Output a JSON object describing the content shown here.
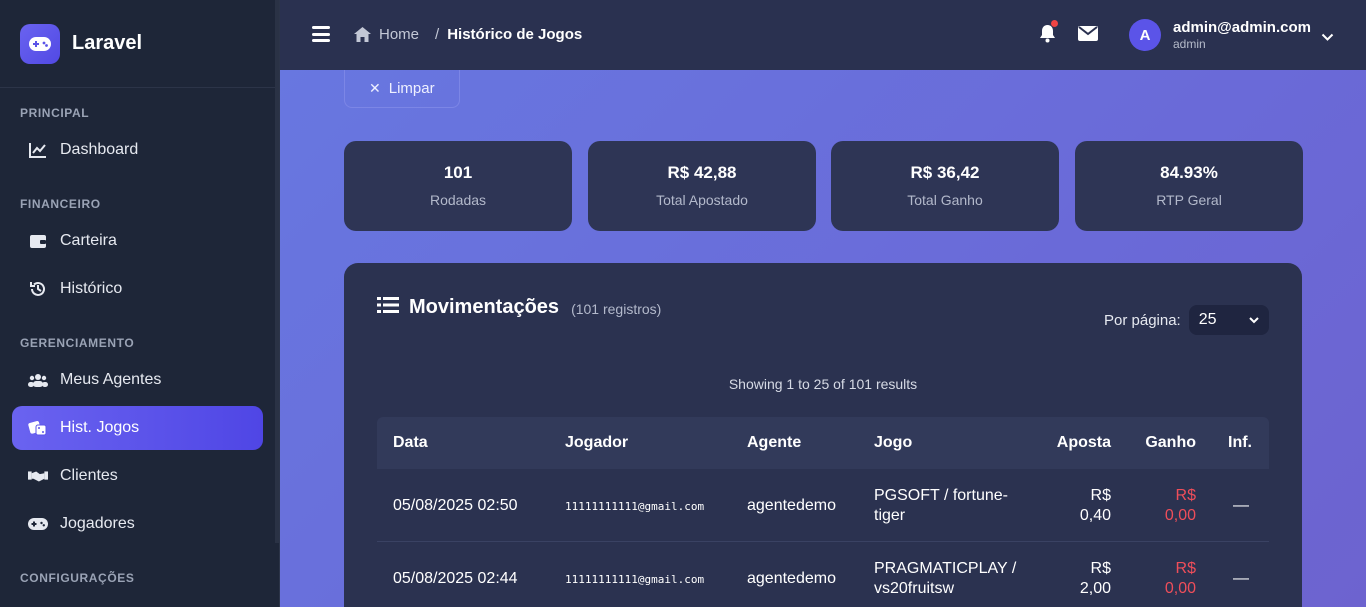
{
  "brand": {
    "name": "Laravel"
  },
  "sidebar": {
    "sections": [
      {
        "title": "PRINCIPAL",
        "items": [
          {
            "label": "Dashboard",
            "icon": "chart-line-icon"
          }
        ]
      },
      {
        "title": "FINANCEIRO",
        "items": [
          {
            "label": "Carteira",
            "icon": "wallet-icon"
          },
          {
            "label": "Histórico",
            "icon": "history-icon"
          }
        ]
      },
      {
        "title": "GERENCIAMENTO",
        "items": [
          {
            "label": "Meus Agentes",
            "icon": "users-icon"
          },
          {
            "label": "Hist. Jogos",
            "icon": "dice-icon",
            "active": true
          },
          {
            "label": "Clientes",
            "icon": "handshake-icon"
          },
          {
            "label": "Jogadores",
            "icon": "gamepad-icon"
          }
        ]
      },
      {
        "title": "CONFIGURAÇÕES",
        "items": []
      }
    ]
  },
  "topbar": {
    "breadcrumb": {
      "home": "Home",
      "separator": "/",
      "current": "Histórico de Jogos"
    },
    "user": {
      "initial": "A",
      "email": "admin@admin.com",
      "role": "admin"
    }
  },
  "filters": {
    "clear_label": "Limpar"
  },
  "stats": [
    {
      "value": "101",
      "label": "Rodadas"
    },
    {
      "value": "R$ 42,88",
      "label": "Total Apostado"
    },
    {
      "value": "R$ 36,42",
      "label": "Total Ganho"
    },
    {
      "value": "84.93%",
      "label": "RTP Geral"
    }
  ],
  "movements": {
    "title": "Movimentações",
    "count": "(101 registros)",
    "per_page_label": "Por página:",
    "per_page_value": "25",
    "showing": "Showing 1 to 25 of 101 results",
    "columns": [
      "Data",
      "Jogador",
      "Agente",
      "Jogo",
      "Aposta",
      "Ganho",
      "Inf."
    ],
    "rows": [
      {
        "data": "05/08/2025 02:50",
        "jogador": "11111111111@gmail.com",
        "agente": "agentedemo",
        "jogo_line1": "PGSOFT / fortune-",
        "jogo_line2": "tiger",
        "aposta_line1": "R$",
        "aposta_line2": "0,40",
        "ganho_line1": "R$",
        "ganho_line2": "0,00",
        "inf": "—"
      },
      {
        "data": "05/08/2025 02:44",
        "jogador": "11111111111@gmail.com",
        "agente": "agentedemo",
        "jogo_line1": "PRAGMATICPLAY /",
        "jogo_line2": "vs20fruitsw",
        "aposta_line1": "R$",
        "aposta_line2": "2,00",
        "ganho_line1": "R$",
        "ganho_line2": "0,00",
        "inf": "—"
      }
    ]
  },
  "colors": {
    "accent": "#5b54e8",
    "negative": "#ef4e5a",
    "sidebar_bg": "#1e2638"
  }
}
